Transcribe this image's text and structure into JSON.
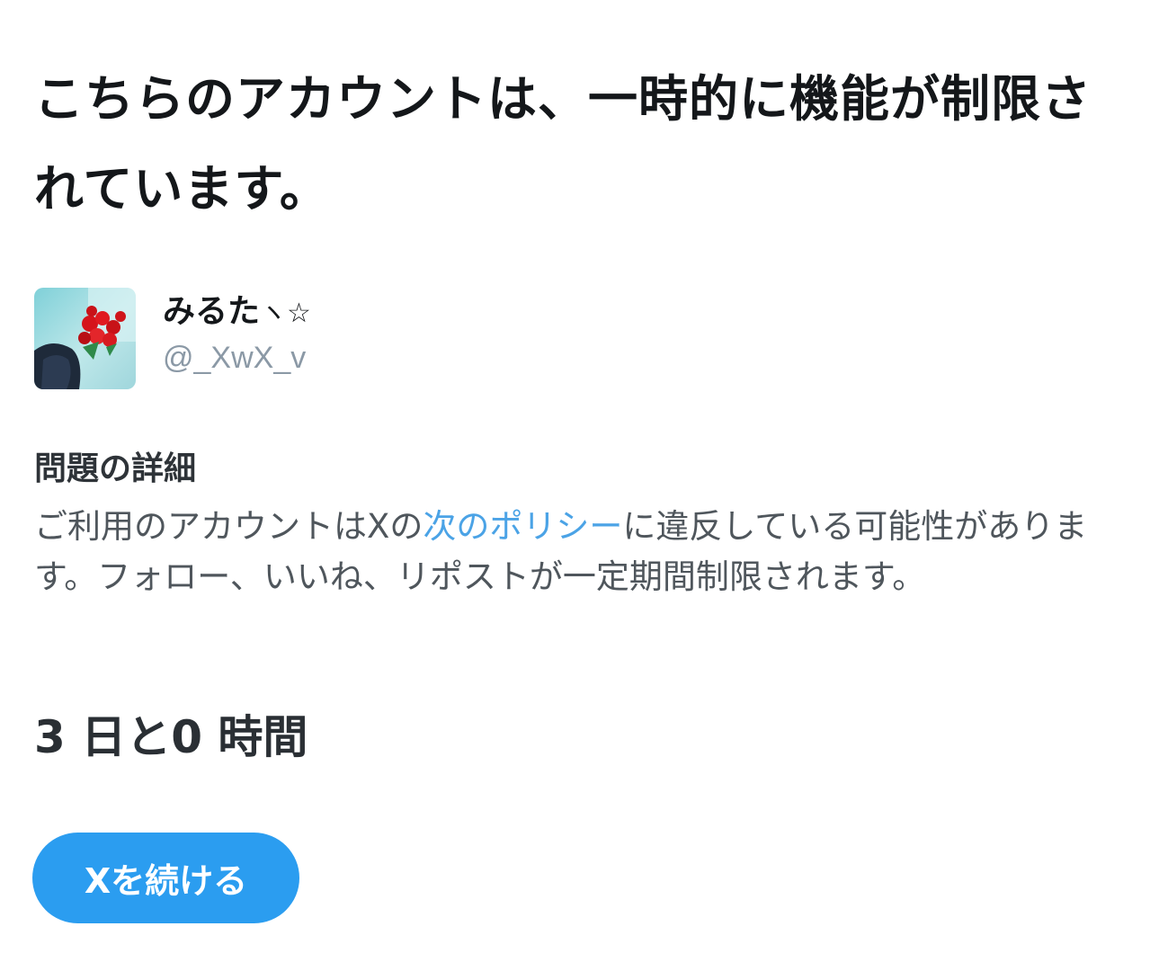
{
  "title": "こちらのアカウントは、一時的に機能が制限されています。",
  "account": {
    "display_name": "みるた",
    "display_name_suffix": "ヽ☆",
    "handle": "@_XwX_v",
    "avatar_icon": "profile-photo-red-roses"
  },
  "details": {
    "heading": "問題の詳細",
    "body_before_link": "ご利用のアカウントはXの",
    "link_text": "次のポリシー",
    "body_after_link": "に違反している可能性があります。フォロー、いいね、リポストが一定期間制限されます。"
  },
  "duration": "3 日と0 時間",
  "continue_button": {
    "label": "Xを続ける"
  },
  "colors": {
    "accent": "#2b9df0",
    "link": "#4ba3e6",
    "handle": "#8b99a6",
    "text": "#14171a"
  }
}
